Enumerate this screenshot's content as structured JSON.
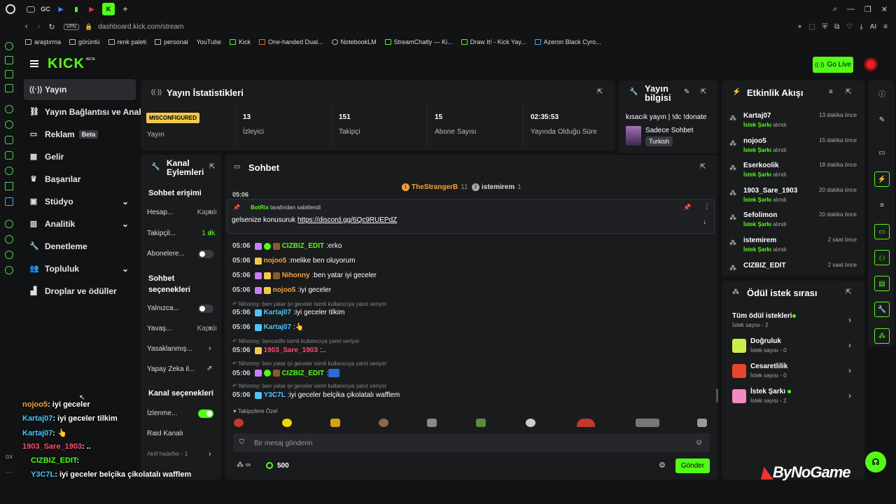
{
  "browser": {
    "tabs": [
      "GC"
    ],
    "url": "dashboard.kick.com/stream",
    "vpn": "VPN",
    "bookmarks": [
      "araştırma",
      "görüntü",
      "renk paleti",
      "personal",
      "YouTube",
      "Kick",
      "One-handed Dual...",
      "NotebookLM",
      "StreamChatly — Ki...",
      "Draw It! - Kick Yay...",
      "Azeron Black Cyro..."
    ]
  },
  "header": {
    "logo": "KICK",
    "beta": "BETA",
    "go_live": "Go Live"
  },
  "sidebar": {
    "items": [
      {
        "label": "Yayın",
        "icon": "broadcast-icon"
      },
      {
        "label": "Yayın Bağlantısı ve Anahtarı",
        "icon": "link-icon"
      },
      {
        "label": "Reklam",
        "icon": "ad-icon",
        "badge": "Beta"
      },
      {
        "label": "Gelir",
        "icon": "revenue-icon"
      },
      {
        "label": "Başarılar",
        "icon": "trophy-icon"
      },
      {
        "label": "Stüdyo",
        "icon": "studio-icon"
      },
      {
        "label": "Analitik",
        "icon": "analytics-icon"
      },
      {
        "label": "Denetleme",
        "icon": "wrench-icon"
      },
      {
        "label": "Topluluk",
        "icon": "community-icon"
      },
      {
        "label": "Droplar ve ödüller",
        "icon": "drops-icon"
      }
    ]
  },
  "stats": {
    "title": "Yayın İstatistikleri",
    "status": "MISCONFIGURED",
    "status_label": "Yayın",
    "items": [
      {
        "value": "13",
        "label": "İzleyici"
      },
      {
        "value": "151",
        "label": "Takipçi"
      },
      {
        "value": "15",
        "label": "Abone Sayısı"
      },
      {
        "value": "02:35:53",
        "label": "Yayında Olduğu Süre"
      }
    ]
  },
  "stream_info": {
    "title": "Yayın bilgisi",
    "stream_title": "kısacık yayın | !dc !donate",
    "category": "Sadece Sohbet",
    "tag": "Turkish"
  },
  "channel_actions": {
    "title": "Kanal Eylemleri",
    "chat_access": "Sohbet erişimi",
    "rows_a": [
      {
        "label": "Hesap...",
        "value": "Kapalı"
      },
      {
        "label": "Takipçil...",
        "value": "1 dk."
      },
      {
        "label": "Abonelere..."
      }
    ],
    "chat_options": "Sohbet seçenekleri",
    "rows_b": [
      {
        "label": "Yalnızca..."
      },
      {
        "label": "Yavaş...",
        "value": "Kapalı"
      },
      {
        "label": "Yasaklanmış..."
      },
      {
        "label": "Yapay Zeka il..."
      }
    ],
    "channel_options": "Kanal seçenekleri",
    "rows_c": [
      {
        "label": "İzlenme..."
      },
      {
        "label": "Raid Kanalı"
      },
      {
        "label": "Aktif hedefler - 1"
      }
    ]
  },
  "chat": {
    "title": "Sohbet",
    "top_gifters": [
      {
        "rank": "1",
        "name": "TheStrangerB",
        "count": "11"
      },
      {
        "rank": "2",
        "name": "istemirem",
        "count": "1"
      }
    ],
    "pinned_by": "BotRix",
    "pinned_label": "tarafından sabitlendi",
    "pinned_text": "gelsenize konusuruk",
    "pinned_link": "https://discord.gg/6Qc9RUEPdZ",
    "messages": [
      {
        "time": "05:06",
        "user": "CIZBIZ_EDIT",
        "color": "#53fc18",
        "text": "erko"
      },
      {
        "time": "05:06",
        "user": "nojoo5",
        "color": "#f2a33a",
        "text": "melike ben oluyorum"
      },
      {
        "time": "05:06",
        "user": "Nihonny",
        "color": "#f2a33a",
        "text": "ben yatar iyi geceler"
      },
      {
        "time": "05:06",
        "user": "nojoo5",
        "color": "#f2a33a",
        "text": "iyi geceler"
      },
      {
        "time": "05:06",
        "user": "Kartaj07",
        "color": "#4fc3f7",
        "text": "iyi geceler tilkim",
        "reply": "Nihonny: ben yatar iyi geceler isimli kullanıcıya yanıt veriyor"
      },
      {
        "time": "05:06",
        "user": "Kartaj07",
        "color": "#4fc3f7",
        "text": "👆"
      },
      {
        "time": "05:06",
        "user": "1903_Sare_1903",
        "color": "#ff4d6d",
        "text": "..",
        "reply": "Nihonny: bencedfe isimli kullanıcıya yanıt veriyor"
      },
      {
        "time": "05:06",
        "user": "CIZBIZ_EDIT",
        "color": "#53fc18",
        "text": "",
        "reply": "Nihonny: ben yatar iyi geceler isimli kullanıcıya yanıt veriyor"
      },
      {
        "time": "05:06",
        "user": "Y3C7L",
        "color": "#4fc3f7",
        "text": "iyi geceler belçika çikolatalı wafflem",
        "reply": "Nihonny: ben yatar iyi geceler isimli kullanıcıya yanıt veriyor"
      }
    ],
    "followers_only": "Takipçilere Özel",
    "placeholder": "Bir mesaj gönderin",
    "points": "500",
    "send": "Gönder",
    "top_partial": "05:06"
  },
  "activity": {
    "title": "Etkinlik Akışı",
    "events": [
      {
        "user": "Kartaj07",
        "time": "13 dakika önce"
      },
      {
        "user": "nojoo5",
        "time": "15 dakika önce"
      },
      {
        "user": "Eserkoolik",
        "time": "18 dakika önce"
      },
      {
        "user": "1903_Sare_1903",
        "time": "20 dakika önce"
      },
      {
        "user": "Sefolimon",
        "time": "20 dakika önce"
      },
      {
        "user": "istemirem",
        "time": "2 saat önce"
      },
      {
        "user": "CIZBIZ_EDIT",
        "time": "2 saat önce"
      }
    ],
    "event_type": "İstek Şarkı",
    "event_suffix": "alındı"
  },
  "rewards": {
    "title": "Ödül istek sırası",
    "items": [
      {
        "name": "Tüm ödül istekleri",
        "sub": "İstek sayısı - 2"
      },
      {
        "name": "Doğruluk",
        "sub": "İstek sayısı - 0",
        "color": "#c8f046"
      },
      {
        "name": "Cesaretlilik",
        "sub": "İstek sayısı - 0",
        "color": "#e8452c"
      },
      {
        "name": "İstek Şarkı",
        "sub": "İstek sayısı - 2",
        "color": "#f48ac2"
      }
    ]
  },
  "overlay": {
    "lines": [
      {
        "user": "nojoo5",
        "color": "#f2a33a",
        "text": ": iyi geceler"
      },
      {
        "user": "Kartaj07",
        "color": "#4fc3f7",
        "text": ": iyi geceler tilkim"
      },
      {
        "user": "Kartaj07",
        "color": "#4fc3f7",
        "text": ": 👆"
      },
      {
        "user": "1903_Sare_1903",
        "color": "#ff4d6d",
        "text": ": .."
      },
      {
        "user": "CIZBIZ_EDIT",
        "color": "#53fc18",
        "text": ":"
      },
      {
        "user": "Y3C7L",
        "color": "#4fc3f7",
        "text": ": iyi geceler belçika çikolatalı wafflem"
      }
    ],
    "watermark": "ByNoGame"
  }
}
